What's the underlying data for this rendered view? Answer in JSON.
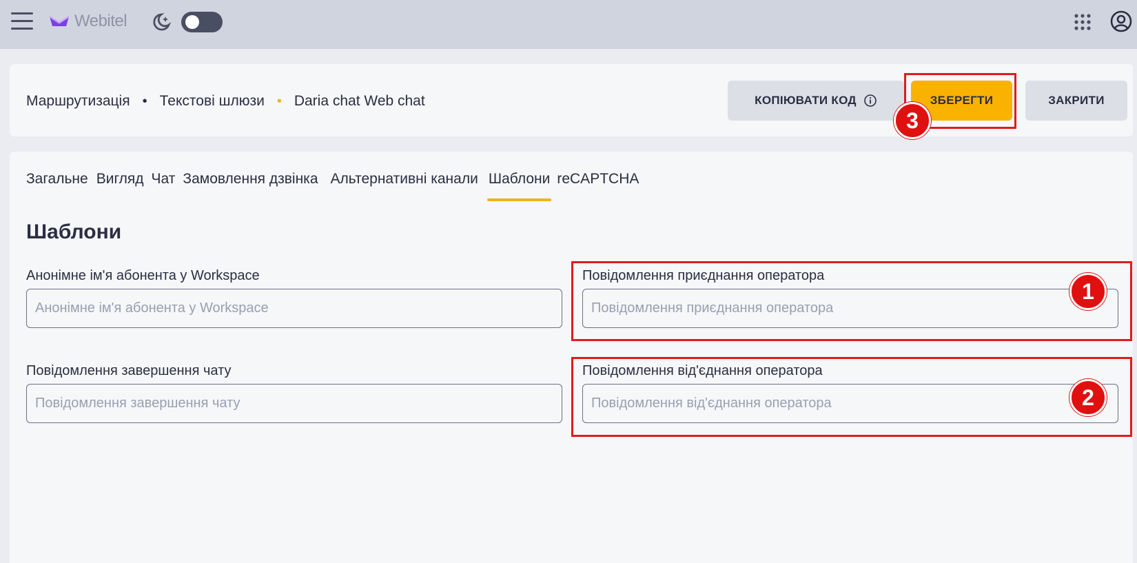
{
  "topbar": {
    "logo_text": "Webitel",
    "theme_toggle": "off"
  },
  "breadcrumb": {
    "items": [
      "Маршрутизація",
      "Текстові шлюзи",
      "Daria chat Web chat"
    ]
  },
  "header_actions": {
    "copy_code_label": "КОПІЮВАТИ КОД",
    "save_label": "ЗБЕРЕГТИ",
    "close_label": "ЗАКРИТИ"
  },
  "tabs": [
    {
      "label": "Загальне",
      "active": false
    },
    {
      "label": "Вигляд",
      "active": false
    },
    {
      "label": "Чат",
      "active": false
    },
    {
      "label": "Замовлення дзвінка",
      "active": false
    },
    {
      "label": "Альтернативні канали",
      "active": false
    },
    {
      "label": "Шаблони",
      "active": true
    },
    {
      "label": "reCAPTCHA",
      "active": false
    }
  ],
  "section_title": "Шаблони",
  "fields": {
    "anon_name": {
      "label": "Анонімне ім'я абонента у Workspace",
      "placeholder": "Анонімне ім'я абонента у Workspace",
      "value": ""
    },
    "operator_join": {
      "label": "Повідомлення приєднання оператора",
      "placeholder": "Повідомлення приєднання оператора",
      "value": ""
    },
    "chat_end": {
      "label": "Повідомлення завершення чату",
      "placeholder": "Повідомлення завершення чату",
      "value": ""
    },
    "operator_leave": {
      "label": "Повідомлення від'єднання оператора",
      "placeholder": "Повідомлення від'єднання оператора",
      "value": ""
    }
  },
  "annotations": {
    "badge_1": "1",
    "badge_2": "2",
    "badge_3": "3"
  },
  "colors": {
    "accent": "#fab200",
    "annotation_red": "#e01b1b",
    "topbar_bg": "#d0d4de"
  }
}
